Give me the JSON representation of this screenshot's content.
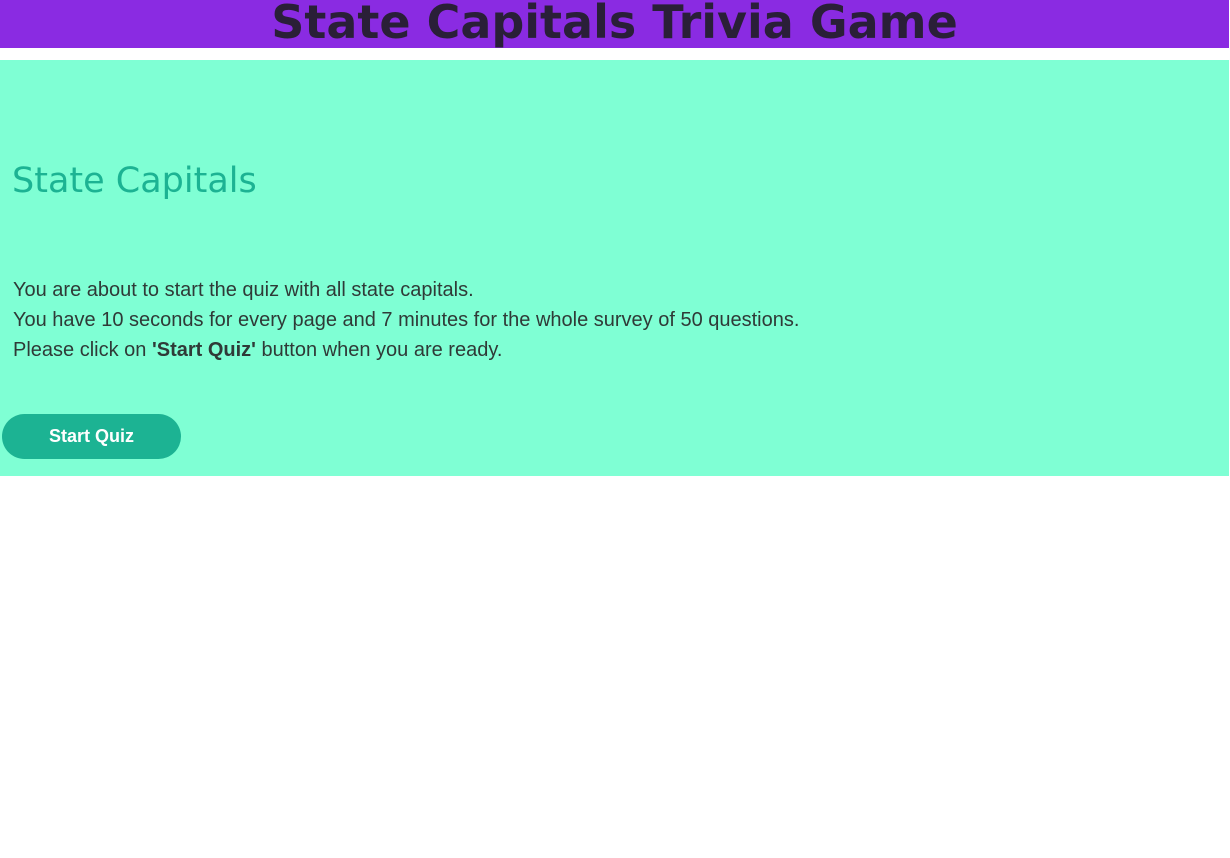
{
  "header": {
    "title": "State Capitals Trivia Game"
  },
  "quiz": {
    "heading": "State Capitals",
    "line1": "You are about to start the quiz with all state capitals.",
    "line2": "You have 10 seconds for every page and 7 minutes for the whole survey of 50 questions.",
    "line3_prefix": "Please click on ",
    "line3_emphasis": "'Start Quiz'",
    "line3_suffix": " button when you are ready.",
    "start_button_label": "Start Quiz"
  },
  "colors": {
    "banner_bg": "#8a2be2",
    "panel_bg": "#7fffd4",
    "accent": "#1cb393",
    "text": "#2f3a37"
  }
}
